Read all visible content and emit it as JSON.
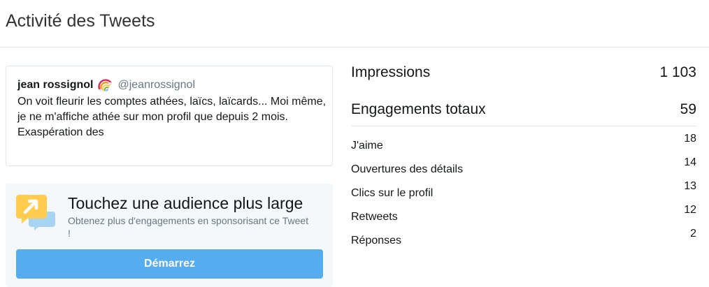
{
  "header": {
    "title": "Activité des Tweets"
  },
  "tweet": {
    "author_name": "jean rossignol",
    "author_emoji": "rainbow-icon",
    "author_handle": "@jeanrossignol",
    "text": "On voit fleurir les comptes athées, laïcs, laïcards... Moi même, je ne m'affiche athée sur mon profil que depuis 2 mois.\nExaspération des"
  },
  "promo": {
    "icon": "promote-arrow-chat-icon",
    "title": "Touchez une audience plus large",
    "subtitle": "Obtenez plus d'engagements en sponsorisant ce Tweet !",
    "button_label": "Démarrez",
    "button_color": "#55acee"
  },
  "stats": {
    "impressions": {
      "label": "Impressions",
      "value": "1 103"
    },
    "engagements": {
      "label": "Engagements totaux",
      "value": "59"
    },
    "breakdown": [
      {
        "label": "J'aime",
        "value": "18"
      },
      {
        "label": "Ouvertures des détails",
        "value": "14"
      },
      {
        "label": "Clics sur le profil",
        "value": "13"
      },
      {
        "label": "Retweets",
        "value": "12"
      },
      {
        "label": "Réponses",
        "value": "2"
      }
    ]
  }
}
